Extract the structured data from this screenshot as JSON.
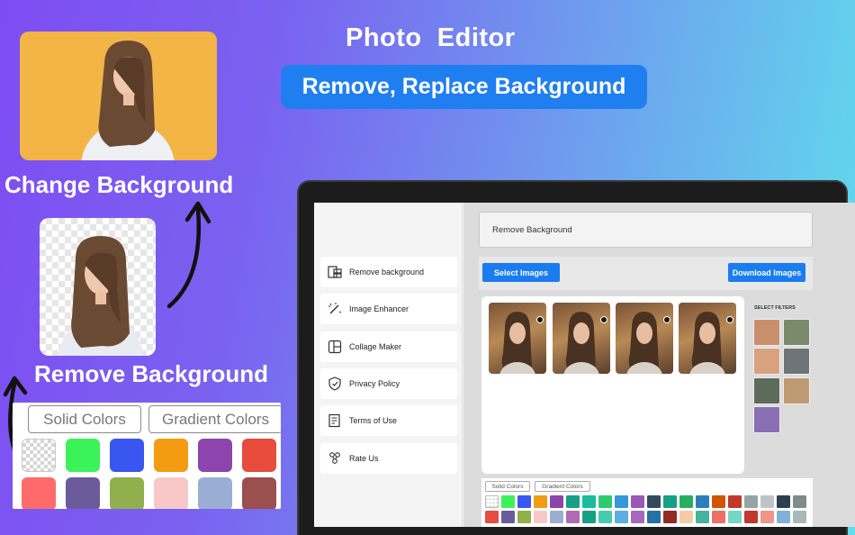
{
  "headline": {
    "title": "Photo  Editor",
    "subtitle": "Remove, Replace Background"
  },
  "showcase": {
    "change_label": "Change Background",
    "remove_label": "Remove Background",
    "swatch_tabs": {
      "solid": "Solid Colors",
      "gradient": "Gradient Colors"
    },
    "swatches": [
      "transparent",
      "#3cf25a",
      "#3a56f0",
      "#f39c12",
      "#8e44ad",
      "#e74c3c",
      "#16c79a",
      "#ff6b6b",
      "#6c5b9b",
      "#8fb04c",
      "#f8c8c8",
      "#9aaed4",
      "#9b4f4f",
      "#b06ab3"
    ],
    "colors": {
      "orange_bg": "#f3b545",
      "blue_pill": "#1f7ff0"
    }
  },
  "app": {
    "sidebar": {
      "items": [
        {
          "label": "Remove background",
          "icon": "layers-icon"
        },
        {
          "label": "Image Enhancer",
          "icon": "magic-wand-icon"
        },
        {
          "label": "Collage Maker",
          "icon": "collage-icon"
        },
        {
          "label": "Privacy Policy",
          "icon": "shield-icon"
        },
        {
          "label": "Terms of Use",
          "icon": "document-icon"
        },
        {
          "label": "Rate Us",
          "icon": "rate-icon"
        }
      ]
    },
    "title": "Remove Background",
    "buttons": {
      "select": "Select Images",
      "download": "Download Images"
    },
    "filters_label": "SELECT FILTERS",
    "swatch_tabs": {
      "solid": "Solid Colors",
      "gradient": "Gradient Colors"
    },
    "swatches": [
      "transparent",
      "#3cf25a",
      "#3a56f0",
      "#f39c12",
      "#8e44ad",
      "#16a085",
      "#1abc9c",
      "#2ecc71",
      "#3498db",
      "#9b59b6",
      "#34495e",
      "#16a085",
      "#27ae60",
      "#2980b9",
      "#d35400",
      "#c0392b",
      "#95a5a6",
      "#bdc3c7",
      "#2c3e50",
      "#7f8c8d",
      "#e74c3c",
      "#6c5b9b",
      "#8fb04c",
      "#f8c8c8",
      "#9aaed4",
      "#b06ab3",
      "#16a085",
      "#48c9b0",
      "#5dade2",
      "#a569bd",
      "#2471a3",
      "#922b21",
      "#f5cba7",
      "#45b39d",
      "#ec7063",
      "#76d7c4",
      "#c0392b",
      "#f1948a",
      "#7fb3d5",
      "#aab7b8"
    ]
  }
}
